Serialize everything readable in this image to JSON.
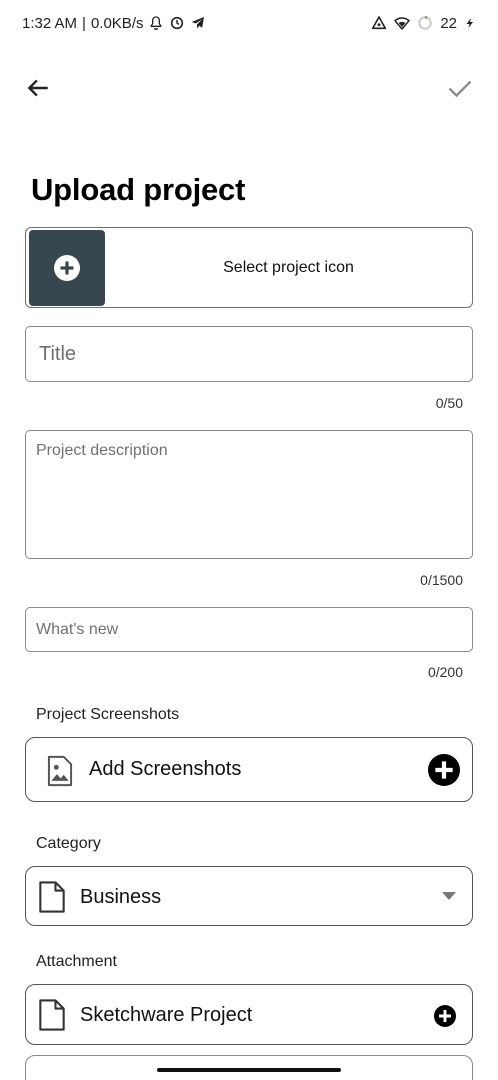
{
  "status_bar": {
    "time": "1:32 AM",
    "separator": "|",
    "net_speed": "0.0KB/s",
    "battery_level": "22",
    "left_icons": [
      "bell-icon",
      "alarm-icon",
      "telegram-icon"
    ],
    "right_icons": [
      "nearby-icon",
      "wifi-icon",
      "battery-ring-icon",
      "charging-icon"
    ]
  },
  "toolbar": {
    "back_icon": "arrow-left-icon",
    "confirm_icon": "checkmark-icon"
  },
  "page": {
    "title": "Upload project"
  },
  "icon_picker": {
    "label": "Select project icon",
    "icon": "add-circle-icon",
    "tile_color": "#37474f"
  },
  "form": {
    "title_placeholder": "Title",
    "title_counter": "0/50",
    "description_placeholder": "Project description",
    "description_counter": "0/1500",
    "whats_new_placeholder": "What's new",
    "whats_new_counter": "0/200"
  },
  "screenshots": {
    "section_label": "Project Screenshots",
    "button_label": "Add Screenshots",
    "icon": "image-icon",
    "action_icon": "add-circle-icon"
  },
  "category": {
    "section_label": "Category",
    "selected_value": "Business",
    "icon": "document-icon",
    "dropdown_icon": "caret-down-icon"
  },
  "attachment": {
    "section_label": "Attachment",
    "label": "Sketchware Project",
    "icon": "document-icon",
    "action_icon": "add-circle-icon"
  }
}
